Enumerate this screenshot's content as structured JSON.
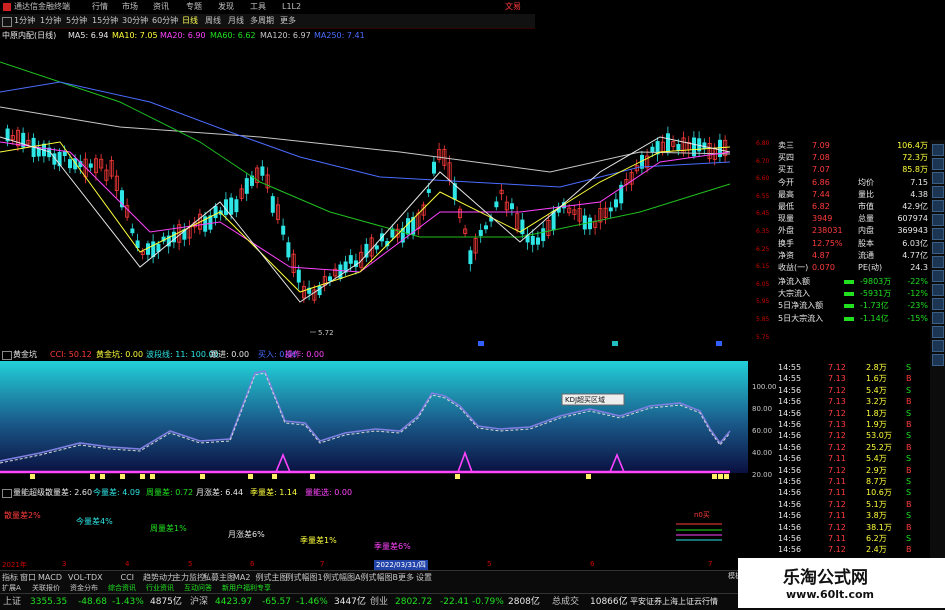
{
  "titlebar": {
    "app_name": "通达信金融终端",
    "menu": [
      "行情",
      "市场",
      "资讯",
      "专题",
      "发现",
      "工具",
      "L1L2"
    ],
    "promo": "文易"
  },
  "toolbar": {
    "periods": [
      "1分钟",
      "1分钟",
      "5分钟",
      "15分钟",
      "30分钟",
      "60分钟",
      "日线",
      "周线",
      "月线",
      "多周期",
      "更多"
    ],
    "active_period": "日线"
  },
  "ma_legend": {
    "stock_name": "中原内配(日线)",
    "items": [
      {
        "label": "MA5: 6.94",
        "color": "#e8e8e8"
      },
      {
        "label": "MA10: 7.05",
        "color": "#ffff3b"
      },
      {
        "label": "MA20: 6.90",
        "color": "#ff44ff"
      },
      {
        "label": "MA60: 6.62",
        "color": "#20e020"
      },
      {
        "label": "MA120: 6.97",
        "color": "#c8c8c8"
      },
      {
        "label": "MA250: 7.41",
        "color": "#4a6cff"
      }
    ]
  },
  "main_chart": {
    "low_marker": "5.72",
    "price_ticks": [
      "6.80",
      "6.70",
      "6.60",
      "6.55",
      "6.45",
      "6.35",
      "6.25",
      "6.15",
      "6.05",
      "5.95",
      "5.85",
      "5.75"
    ],
    "up_color": "#ff3b3b",
    "down_color": "#2ee6e6"
  },
  "quote_panel": {
    "rows": [
      {
        "label": "卖三",
        "value": "7.09",
        "right": "106.4万"
      },
      {
        "label": "买四",
        "value": "7.08",
        "right": "72.3万"
      },
      {
        "label": "买五",
        "value": "7.07",
        "right": "85.8万"
      },
      {
        "label": "今开",
        "value": "6.86",
        "right_label": "均价",
        "right": "7.15"
      },
      {
        "label": "最高",
        "value": "7.44",
        "right_label": "量比",
        "right": "4.38"
      },
      {
        "label": "最低",
        "value": "6.82",
        "right_label": "市值",
        "right": "42.9亿"
      },
      {
        "label": "现量",
        "value": "3949",
        "right_label": "总量",
        "right": "607974"
      },
      {
        "label": "外盘",
        "value": "238031",
        "right_label": "内盘",
        "right": "369943"
      },
      {
        "label": "换手",
        "value": "12.75%",
        "right_label": "股本",
        "right": "6.03亿"
      },
      {
        "label": "净资",
        "value": "4.87",
        "right_label": "流通",
        "right": "4.77亿"
      },
      {
        "label": "收益(一)",
        "value": "0.070",
        "right_label": "PE(动)",
        "right": "24.3"
      }
    ],
    "flows": [
      {
        "label": "净流入额",
        "value": "-9803万",
        "pct": "-22%"
      },
      {
        "label": "大宗流入",
        "value": "-5931万",
        "pct": "-12%"
      },
      {
        "label": "5日净流入额",
        "value": "-1.73亿",
        "pct": "-23%"
      },
      {
        "label": "5日大宗流入",
        "value": "-1.14亿",
        "pct": "-15%"
      }
    ]
  },
  "ticks": [
    {
      "time": "14:55",
      "price": "7.12",
      "vol": "2.8万",
      "side": "S"
    },
    {
      "time": "14:55",
      "price": "7.13",
      "vol": "1.6万",
      "side": "B"
    },
    {
      "time": "14:56",
      "price": "7.12",
      "vol": "5.4万",
      "side": "S"
    },
    {
      "time": "14:56",
      "price": "7.13",
      "vol": "3.2万",
      "side": "B"
    },
    {
      "time": "14:56",
      "price": "7.12",
      "vol": "1.8万",
      "side": "S"
    },
    {
      "time": "14:56",
      "price": "7.13",
      "vol": "1.9万",
      "side": "B"
    },
    {
      "time": "14:56",
      "price": "7.12",
      "vol": "53.0万",
      "side": "S"
    },
    {
      "time": "14:56",
      "price": "7.12",
      "vol": "25.2万",
      "side": "B"
    },
    {
      "time": "14:56",
      "price": "7.11",
      "vol": "5.4万",
      "side": "S"
    },
    {
      "time": "14:56",
      "price": "7.12",
      "vol": "2.9万",
      "side": "B"
    },
    {
      "time": "14:56",
      "price": "7.11",
      "vol": "8.7万",
      "side": "S"
    },
    {
      "time": "14:56",
      "price": "7.11",
      "vol": "10.6万",
      "side": "S"
    },
    {
      "time": "14:56",
      "price": "7.12",
      "vol": "5.1万",
      "side": "B"
    },
    {
      "time": "14:56",
      "price": "7.11",
      "vol": "3.8万",
      "side": "S"
    },
    {
      "time": "14:56",
      "price": "7.12",
      "vol": "38.1万",
      "side": "B"
    },
    {
      "time": "14:56",
      "price": "7.11",
      "vol": "6.2万",
      "side": "S"
    },
    {
      "time": "14:56",
      "price": "7.12",
      "vol": "2.4万",
      "side": "B"
    }
  ],
  "gold_panel": {
    "title": "黄金坑",
    "legend": [
      {
        "label": "CCI: 50.12",
        "color": "#ff3b3b"
      },
      {
        "label": "黄金坑: 0.00",
        "color": "#ffff3b"
      },
      {
        "label": "波段线: 11: 100.00",
        "color": "#2ee6e6"
      },
      {
        "label": "跟进: 0.00",
        "color": "#e8e8e8"
      },
      {
        "label": "买入: 0.00",
        "color": "#4a6cff"
      },
      {
        "label": "操作: 0.00",
        "color": "#ff44ff"
      }
    ],
    "axis_ticks": [
      "100.00",
      "80.00",
      "60.00",
      "40.00",
      "20.00"
    ],
    "tooltip": "KDJ超买区域"
  },
  "volume_panel": {
    "title": "量能超级",
    "legend": [
      {
        "label": "散量差: 2.60",
        "color": "#e8e8e8"
      },
      {
        "label": "今量差: 4.09",
        "color": "#2ee6e6"
      },
      {
        "label": "周量差: 0.72",
        "color": "#20e020"
      },
      {
        "label": "月涨差: 6.44",
        "color": "#e8e8e8"
      },
      {
        "label": "季量差: 1.14",
        "color": "#ffff3b"
      },
      {
        "label": "量能选: 0.00",
        "color": "#ff44ff"
      }
    ],
    "annotations": [
      {
        "text": "散量差2%",
        "color": "#ff3b3b"
      },
      {
        "text": "今量差4%",
        "color": "#2ee6e6"
      },
      {
        "text": "周量差1%",
        "color": "#20e020"
      },
      {
        "text": "月涨差6%",
        "color": "#e8e8e8"
      },
      {
        "text": "季量差1%",
        "color": "#ffff3b"
      },
      {
        "text": "季量差6%",
        "color": "#ff44ff"
      },
      {
        "text": "n0买",
        "color": "#ff3b3b"
      }
    ]
  },
  "date_axis": {
    "labels": [
      "2021年",
      "3",
      "4",
      "5",
      "6",
      "7",
      "2022/03/31/四",
      "5",
      "6",
      "7"
    ],
    "highlight": "2022/03/31/四"
  },
  "indicator_tabs": [
    "指标",
    "窗口",
    "MACD",
    "VOL-TDX",
    "CCI",
    "趋势动力",
    "主力监控",
    "私募主图",
    "MA2",
    "例式主图",
    "例式幅图1",
    "例式幅图A",
    "例式幅图B",
    "更多",
    "设置"
  ],
  "sub_tabs": [
    "扩展A",
    "关联报价",
    "资金分布",
    "综合资讯",
    "行业资讯",
    "互动问答",
    "新用户福利专享"
  ],
  "panel_right_tab": "模板",
  "status_bar": {
    "sh_label": "上证",
    "sh_value": "3355.35",
    "sh_change": "-48.68",
    "sh_pct": "-1.43%",
    "sh_amount": "4875亿",
    "sz_label": "沪深",
    "sz_value": "4423.97",
    "sz_change": "-65.57",
    "sz_pct": "-1.46%",
    "sz_amount": "3447亿",
    "cy_label": "创业",
    "cy_value": "2802.72",
    "cy_change": "-22.41",
    "cy_pct": "-0.79%",
    "cy_amount": "2808亿",
    "total_label": "总成交",
    "total_value": "10866亿",
    "message": "平安证券上海上证云行情"
  },
  "watermark": {
    "title": "乐淘公式网",
    "url": "www.60lt.com"
  }
}
